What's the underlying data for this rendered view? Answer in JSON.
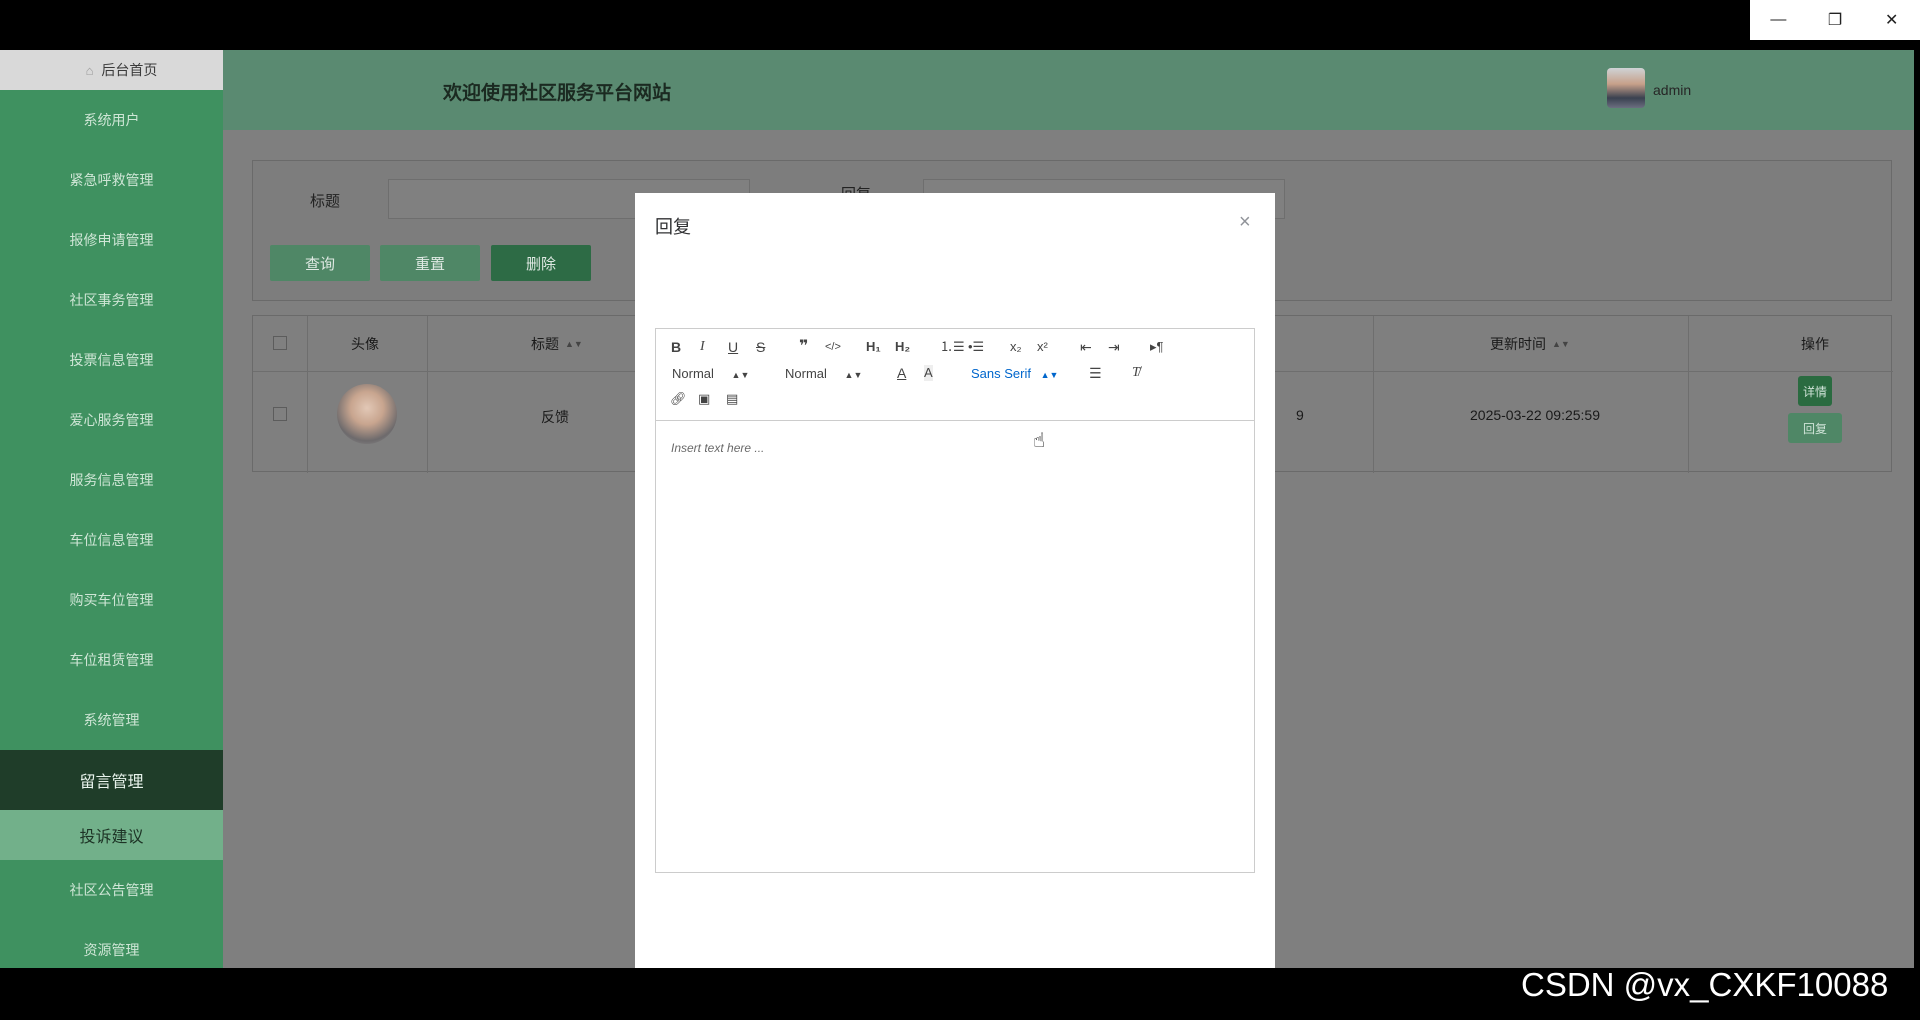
{
  "window": {
    "minimize_glyph": "—",
    "restore_glyph": "❐",
    "close_glyph": "✕"
  },
  "sidebar": {
    "home": "后台首页",
    "items": [
      "系统用户",
      "紧急呼救管理",
      "报修申请管理",
      "社区事务管理",
      "投票信息管理",
      "爱心服务管理",
      "服务信息管理",
      "车位信息管理",
      "购买车位管理",
      "车位租赁管理",
      "系统管理"
    ],
    "active_parent": "留言管理",
    "active_child": "投诉建议",
    "items_after": [
      "社区公告管理",
      "资源管理"
    ]
  },
  "header": {
    "welcome": "欢迎使用社区服务平台网站",
    "username": "admin"
  },
  "search": {
    "title_label": "标题",
    "status_label": "回复",
    "query_button": "查询",
    "reset_button": "重置",
    "delete_button": "删除"
  },
  "table": {
    "columns": {
      "avatar": "头像",
      "title": "标题",
      "updated": "更新时间",
      "actions": "操作"
    },
    "rows": [
      {
        "title": "反馈",
        "partial_time": "9",
        "updated": "2025-03-22 09:25:59",
        "detail_button": "详情",
        "reply_button": "回复"
      }
    ]
  },
  "modal": {
    "title": "回复",
    "close_glyph": "×",
    "editor": {
      "header_select": "Normal",
      "size_select": "Normal",
      "font_select": "Sans Serif",
      "placeholder": "Insert text here ..."
    }
  },
  "watermark": "CSDN @vx_CXKF10088",
  "colors": {
    "sidebar": "#3f9160",
    "sidebar_active": "#1f3d29",
    "sidebar_active_child": "#72b08a",
    "accent_blue": "#0066cc"
  }
}
